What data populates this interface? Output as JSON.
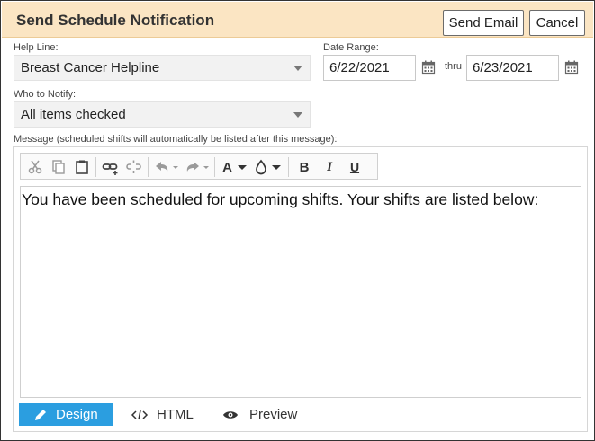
{
  "dialog": {
    "title": "Send Schedule Notification",
    "send_email_label": "Send Email",
    "cancel_label": "Cancel"
  },
  "help_line": {
    "label": "Help Line:",
    "selected": "Breast Cancer Helpline"
  },
  "date_range": {
    "label": "Date Range:",
    "from": "6/22/2021",
    "thru_label": "thru",
    "to": "6/23/2021"
  },
  "who_to_notify": {
    "label": "Who to Notify:",
    "selected": "All items checked"
  },
  "message": {
    "label": "Message (scheduled shifts will automatically be listed after this message):",
    "body": "You have been scheduled for upcoming shifts. Your shifts are listed below:"
  },
  "toolbar": {
    "icons": [
      "cut-icon",
      "copy-icon",
      "paste-icon",
      "link-icon",
      "unlink-icon",
      "undo-icon",
      "redo-icon",
      "font-color-icon",
      "background-color-icon",
      "bold-icon",
      "italic-icon",
      "underline-icon"
    ],
    "bold_glyph": "B",
    "italic_glyph": "I",
    "underline_glyph": "U",
    "font_color_glyph": "A"
  },
  "modes": {
    "design": "Design",
    "html": "HTML",
    "preview": "Preview"
  },
  "colors": {
    "title_bar": "#fbe5c3",
    "design_tab_active": "#2b9ee0"
  }
}
